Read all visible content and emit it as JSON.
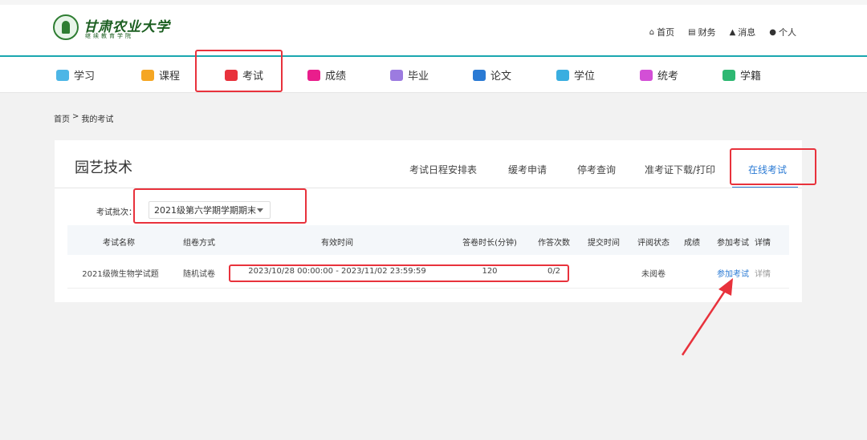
{
  "header": {
    "logo_name": "甘肃农业大学",
    "logo_sub": "继续教育学院",
    "links": [
      {
        "icon": "home-icon",
        "label": "首页"
      },
      {
        "icon": "finance-icon",
        "label": "财务"
      },
      {
        "icon": "bell-icon",
        "label": "消息"
      },
      {
        "icon": "user-icon",
        "label": "个人"
      }
    ]
  },
  "nav": {
    "items": [
      {
        "label": "学习",
        "color": "#4db6e6"
      },
      {
        "label": "课程",
        "color": "#f5a623"
      },
      {
        "label": "考试",
        "color": "#e8323c"
      },
      {
        "label": "成绩",
        "color": "#e91e8c"
      },
      {
        "label": "毕业",
        "color": "#9c7be0"
      },
      {
        "label": "论文",
        "color": "#2a7ad4"
      },
      {
        "label": "学位",
        "color": "#3aaee0"
      },
      {
        "label": "统考",
        "color": "#d34fd6"
      },
      {
        "label": "学籍",
        "color": "#2eb872"
      }
    ]
  },
  "breadcrumb": {
    "home": "首页",
    "sep": ">",
    "current": "我的考试"
  },
  "card": {
    "title": "园艺技术",
    "tabs": [
      "考试日程安排表",
      "缓考申请",
      "停考查询",
      "准考证下载/打印",
      "在线考试"
    ],
    "batch_label": "考试批次：",
    "batch_value": "2021级第六学期学期期末"
  },
  "table": {
    "headers": [
      "考试名称",
      "组卷方式",
      "有效时间",
      "答卷时长(分钟)",
      "作答次数",
      "提交时间",
      "评阅状态",
      "成绩",
      "参加考试",
      "详情"
    ],
    "rows": [
      {
        "name": "2021级微生物学试题",
        "method": "随机试卷",
        "valid_time": "2023/10/28 00:00:00 - 2023/11/02 23:59:59",
        "duration": "120",
        "attempts": "0/2",
        "submit_time": "",
        "review_status": "未阅卷",
        "score": "",
        "join": "参加考试",
        "detail": "详情"
      }
    ]
  },
  "colors": {
    "accent": "#2a7ad4",
    "teal": "#1aa7b0",
    "highlight": "#e8323c"
  }
}
